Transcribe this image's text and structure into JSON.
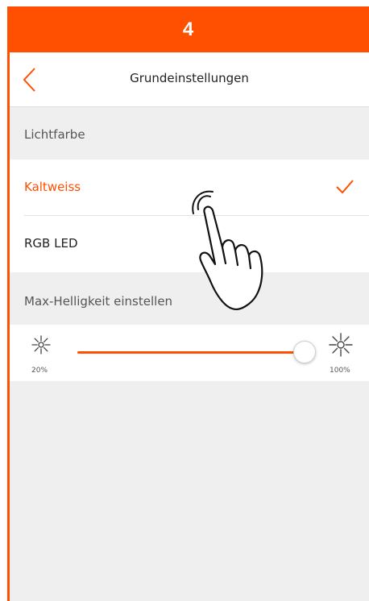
{
  "step": {
    "number": "4"
  },
  "header": {
    "title": "Grundeinstellungen",
    "back_icon": "chevron-left-icon"
  },
  "light_color": {
    "section_label": "Lichtfarbe",
    "options": [
      {
        "label": "Kaltweiss",
        "selected": true
      },
      {
        "label": "RGB LED",
        "selected": false
      }
    ]
  },
  "brightness": {
    "section_label": "Max-Helligkeit einstellen",
    "min_label": "20%",
    "max_label": "100%",
    "value_fraction": 1.0,
    "min_icon": "sun-small-icon",
    "max_icon": "sun-large-icon"
  },
  "colors": {
    "accent": "#fe5000",
    "background": "#efefef",
    "text_dark": "#222222",
    "text_muted": "#555555"
  },
  "overlay": {
    "icon": "tapping-hand-icon"
  }
}
